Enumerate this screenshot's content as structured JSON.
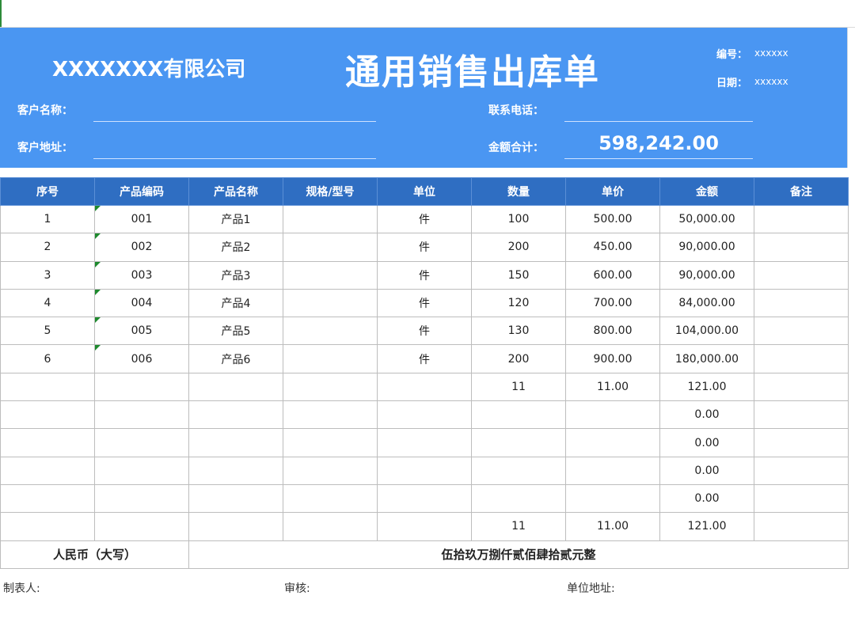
{
  "header": {
    "company": "XXXXXXX有限公司",
    "title": "通用销售出库单",
    "number_label": "编号：",
    "number_value": "xxxxxx",
    "date_label": "日期：",
    "date_value": "xxxxxx",
    "customer_name_label": "客户名称：",
    "customer_address_label": "客户地址：",
    "phone_label": "联系电话：",
    "amount_total_label": "金额合计：",
    "amount_total_value": "598,242.00"
  },
  "table": {
    "columns": [
      "序号",
      "产品编码",
      "产品名称",
      "规格/型号",
      "单位",
      "数量",
      "单价",
      "金额",
      "备注"
    ],
    "rows": [
      [
        "1",
        "001",
        "产品1",
        "",
        "件",
        "100",
        "500.00",
        "50,000.00",
        ""
      ],
      [
        "2",
        "002",
        "产品2",
        "",
        "件",
        "200",
        "450.00",
        "90,000.00",
        ""
      ],
      [
        "3",
        "003",
        "产品3",
        "",
        "件",
        "150",
        "600.00",
        "90,000.00",
        ""
      ],
      [
        "4",
        "004",
        "产品4",
        "",
        "件",
        "120",
        "700.00",
        "84,000.00",
        ""
      ],
      [
        "5",
        "005",
        "产品5",
        "",
        "件",
        "130",
        "800.00",
        "104,000.00",
        ""
      ],
      [
        "6",
        "006",
        "产品6",
        "",
        "件",
        "200",
        "900.00",
        "180,000.00",
        ""
      ],
      [
        "",
        "",
        "",
        "",
        "",
        "11",
        "11.00",
        "121.00",
        ""
      ],
      [
        "",
        "",
        "",
        "",
        "",
        "",
        "",
        "0.00",
        ""
      ],
      [
        "",
        "",
        "",
        "",
        "",
        "",
        "",
        "0.00",
        ""
      ],
      [
        "",
        "",
        "",
        "",
        "",
        "",
        "",
        "0.00",
        ""
      ],
      [
        "",
        "",
        "",
        "",
        "",
        "",
        "",
        "0.00",
        ""
      ],
      [
        "",
        "",
        "",
        "",
        "",
        "11",
        "11.00",
        "121.00",
        ""
      ]
    ],
    "flagged_rows": 6,
    "sum_label": "人民币（大写）",
    "sum_text": "伍拾玖万捌仟贰佰肆拾贰元整"
  },
  "footer": {
    "maker_label": "制表人:",
    "review_label": "审核:",
    "unit_address_label": "单位地址:"
  },
  "colors": {
    "header_bg": "#4a96f2",
    "table_header_bg": "#2f6ec2",
    "comment_flag": "#1e8a2e"
  }
}
